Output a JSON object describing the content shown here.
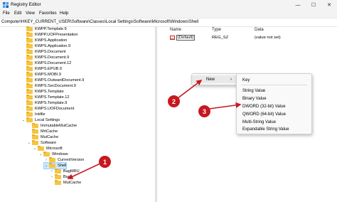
{
  "window": {
    "title": "Registry Editor",
    "minimize": "—",
    "maximize": "☐",
    "close": "✕"
  },
  "menu": [
    "File",
    "Edit",
    "View",
    "Favorites",
    "Help"
  ],
  "address": "Computer\\HKEY_CURRENT_USER\\Software\\Classes\\Local Settings\\Software\\Microsoft\\Windows\\Shell",
  "tree": [
    {
      "label": "KWPP.Template.9",
      "chev": ""
    },
    {
      "label": "KWPP.UOFPresentation",
      "chev": ""
    },
    {
      "label": "KWPS.Application",
      "chev": ""
    },
    {
      "label": "KWPS.Application.9",
      "chev": ""
    },
    {
      "label": "KWPS.Document",
      "chev": ""
    },
    {
      "label": "KWPS.Document.9",
      "chev": ""
    },
    {
      "label": "KWPS.Document.12",
      "chev": ""
    },
    {
      "label": "KWPS.EPUB.9",
      "chev": ""
    },
    {
      "label": "KWPS.MOBI.9",
      "chev": ""
    },
    {
      "label": "KWPS.OutwardDocument.9",
      "chev": ""
    },
    {
      "label": "KWPS.SecDocument.9",
      "chev": ""
    },
    {
      "label": "KWPS.Template",
      "chev": ""
    },
    {
      "label": "KWPS.Template.12",
      "chev": ""
    },
    {
      "label": "KWPS.Template.9",
      "chev": ""
    },
    {
      "label": "KWPS.UOFDocument",
      "chev": ""
    },
    {
      "label": "Inkfile",
      "chev": ""
    },
    {
      "label": "Local Settings",
      "chev": "⌄"
    },
    {
      "label": "ImmutableMuiCache",
      "chev": ""
    },
    {
      "label": "MrtCache",
      "chev": ""
    },
    {
      "label": "MuiCache",
      "chev": ""
    },
    {
      "label": "Software",
      "chev": "⌄"
    },
    {
      "label": "Microsoft",
      "chev": "⌄"
    },
    {
      "label": "Windows",
      "chev": "⌄"
    },
    {
      "label": "CurrentVersion",
      "chev": "›"
    },
    {
      "label": "Shell",
      "chev": "⌄"
    },
    {
      "label": "BagMRU",
      "chev": "›"
    },
    {
      "label": "Bags",
      "chev": "›"
    },
    {
      "label": "MuiCache",
      "chev": ""
    }
  ],
  "columns": {
    "name": "Name",
    "type": "Type",
    "data": "Data"
  },
  "value_row": {
    "icon": "ab",
    "name": "(Default)",
    "type": "REG_SZ",
    "data": "(value not set)"
  },
  "context_menu": {
    "new_label": "New",
    "arrow": "›"
  },
  "submenu": [
    "Key",
    "String Value",
    "Binary Value",
    "DWORD (32-bit) Value",
    "QWORD (64-bit) Value",
    "Multi-String Value",
    "Expandable String Value"
  ],
  "badges": [
    "1",
    "2",
    "3"
  ],
  "colors": {
    "badge": "#c8181f",
    "folder": "#f5c542",
    "selection": "#cce8ff"
  }
}
